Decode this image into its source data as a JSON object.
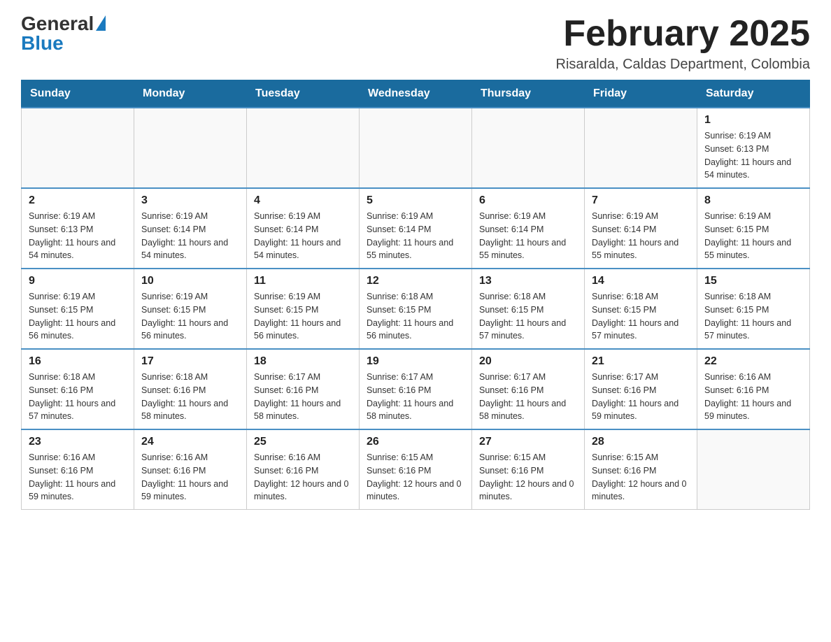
{
  "logo": {
    "general": "General",
    "blue": "Blue"
  },
  "header": {
    "title": "February 2025",
    "location": "Risaralda, Caldas Department, Colombia"
  },
  "days_of_week": [
    "Sunday",
    "Monday",
    "Tuesday",
    "Wednesday",
    "Thursday",
    "Friday",
    "Saturday"
  ],
  "weeks": [
    [
      {
        "day": "",
        "info": ""
      },
      {
        "day": "",
        "info": ""
      },
      {
        "day": "",
        "info": ""
      },
      {
        "day": "",
        "info": ""
      },
      {
        "day": "",
        "info": ""
      },
      {
        "day": "",
        "info": ""
      },
      {
        "day": "1",
        "info": "Sunrise: 6:19 AM\nSunset: 6:13 PM\nDaylight: 11 hours and 54 minutes."
      }
    ],
    [
      {
        "day": "2",
        "info": "Sunrise: 6:19 AM\nSunset: 6:13 PM\nDaylight: 11 hours and 54 minutes."
      },
      {
        "day": "3",
        "info": "Sunrise: 6:19 AM\nSunset: 6:14 PM\nDaylight: 11 hours and 54 minutes."
      },
      {
        "day": "4",
        "info": "Sunrise: 6:19 AM\nSunset: 6:14 PM\nDaylight: 11 hours and 54 minutes."
      },
      {
        "day": "5",
        "info": "Sunrise: 6:19 AM\nSunset: 6:14 PM\nDaylight: 11 hours and 55 minutes."
      },
      {
        "day": "6",
        "info": "Sunrise: 6:19 AM\nSunset: 6:14 PM\nDaylight: 11 hours and 55 minutes."
      },
      {
        "day": "7",
        "info": "Sunrise: 6:19 AM\nSunset: 6:14 PM\nDaylight: 11 hours and 55 minutes."
      },
      {
        "day": "8",
        "info": "Sunrise: 6:19 AM\nSunset: 6:15 PM\nDaylight: 11 hours and 55 minutes."
      }
    ],
    [
      {
        "day": "9",
        "info": "Sunrise: 6:19 AM\nSunset: 6:15 PM\nDaylight: 11 hours and 56 minutes."
      },
      {
        "day": "10",
        "info": "Sunrise: 6:19 AM\nSunset: 6:15 PM\nDaylight: 11 hours and 56 minutes."
      },
      {
        "day": "11",
        "info": "Sunrise: 6:19 AM\nSunset: 6:15 PM\nDaylight: 11 hours and 56 minutes."
      },
      {
        "day": "12",
        "info": "Sunrise: 6:18 AM\nSunset: 6:15 PM\nDaylight: 11 hours and 56 minutes."
      },
      {
        "day": "13",
        "info": "Sunrise: 6:18 AM\nSunset: 6:15 PM\nDaylight: 11 hours and 57 minutes."
      },
      {
        "day": "14",
        "info": "Sunrise: 6:18 AM\nSunset: 6:15 PM\nDaylight: 11 hours and 57 minutes."
      },
      {
        "day": "15",
        "info": "Sunrise: 6:18 AM\nSunset: 6:15 PM\nDaylight: 11 hours and 57 minutes."
      }
    ],
    [
      {
        "day": "16",
        "info": "Sunrise: 6:18 AM\nSunset: 6:16 PM\nDaylight: 11 hours and 57 minutes."
      },
      {
        "day": "17",
        "info": "Sunrise: 6:18 AM\nSunset: 6:16 PM\nDaylight: 11 hours and 58 minutes."
      },
      {
        "day": "18",
        "info": "Sunrise: 6:17 AM\nSunset: 6:16 PM\nDaylight: 11 hours and 58 minutes."
      },
      {
        "day": "19",
        "info": "Sunrise: 6:17 AM\nSunset: 6:16 PM\nDaylight: 11 hours and 58 minutes."
      },
      {
        "day": "20",
        "info": "Sunrise: 6:17 AM\nSunset: 6:16 PM\nDaylight: 11 hours and 58 minutes."
      },
      {
        "day": "21",
        "info": "Sunrise: 6:17 AM\nSunset: 6:16 PM\nDaylight: 11 hours and 59 minutes."
      },
      {
        "day": "22",
        "info": "Sunrise: 6:16 AM\nSunset: 6:16 PM\nDaylight: 11 hours and 59 minutes."
      }
    ],
    [
      {
        "day": "23",
        "info": "Sunrise: 6:16 AM\nSunset: 6:16 PM\nDaylight: 11 hours and 59 minutes."
      },
      {
        "day": "24",
        "info": "Sunrise: 6:16 AM\nSunset: 6:16 PM\nDaylight: 11 hours and 59 minutes."
      },
      {
        "day": "25",
        "info": "Sunrise: 6:16 AM\nSunset: 6:16 PM\nDaylight: 12 hours and 0 minutes."
      },
      {
        "day": "26",
        "info": "Sunrise: 6:15 AM\nSunset: 6:16 PM\nDaylight: 12 hours and 0 minutes."
      },
      {
        "day": "27",
        "info": "Sunrise: 6:15 AM\nSunset: 6:16 PM\nDaylight: 12 hours and 0 minutes."
      },
      {
        "day": "28",
        "info": "Sunrise: 6:15 AM\nSunset: 6:16 PM\nDaylight: 12 hours and 0 minutes."
      },
      {
        "day": "",
        "info": ""
      }
    ]
  ]
}
